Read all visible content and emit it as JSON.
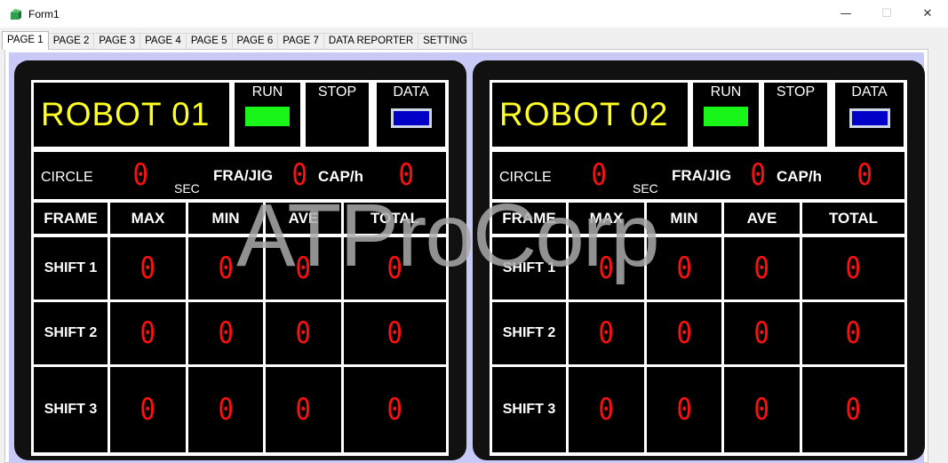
{
  "window": {
    "title": "Form1",
    "minimize_glyph": "—",
    "maximize_glyph": "☐",
    "close_glyph": "✕"
  },
  "tabs": [
    {
      "label": "PAGE 1",
      "active": true
    },
    {
      "label": "PAGE 2"
    },
    {
      "label": "PAGE 3"
    },
    {
      "label": "PAGE 4"
    },
    {
      "label": "PAGE 5"
    },
    {
      "label": "PAGE 6"
    },
    {
      "label": "PAGE 7"
    },
    {
      "label": "DATA REPORTER"
    },
    {
      "label": "SETTING"
    }
  ],
  "labels": {
    "run": "RUN",
    "stop": "STOP",
    "data": "DATA",
    "circle": "CIRCLE",
    "sec": "SEC",
    "fra_jig": "FRA/JIG",
    "cap_h": "CAP/h",
    "frame": "FRAME",
    "max": "MAX",
    "min": "MIN",
    "ave": "AVE",
    "total": "TOTAL",
    "shift1": "SHIFT 1",
    "shift2": "SHIFT 2",
    "shift3": "SHIFT 3"
  },
  "robots": [
    {
      "name": "ROBOT 01",
      "circle": "0",
      "fra_jig": "0",
      "cap_h": "0",
      "shifts": [
        {
          "max": "0",
          "min": "0",
          "ave": "0",
          "total": "0"
        },
        {
          "max": "0",
          "min": "0",
          "ave": "0",
          "total": "0"
        },
        {
          "max": "0",
          "min": "0",
          "ave": "0",
          "total": "0"
        }
      ]
    },
    {
      "name": "ROBOT 02",
      "circle": "0",
      "fra_jig": "0",
      "cap_h": "0",
      "shifts": [
        {
          "max": "0",
          "min": "0",
          "ave": "0",
          "total": "0"
        },
        {
          "max": "0",
          "min": "0",
          "ave": "0",
          "total": "0"
        },
        {
          "max": "0",
          "min": "0",
          "ave": "0",
          "total": "0"
        }
      ]
    }
  ],
  "watermark": "ATProCorp",
  "colors": {
    "robot_title": "#ffff22",
    "digits": "#ff1010",
    "run_lamp": "#19f519",
    "data_lamp": "#0000c8",
    "panel_bg": "#111111",
    "page_bg": "#c9c9f7"
  }
}
